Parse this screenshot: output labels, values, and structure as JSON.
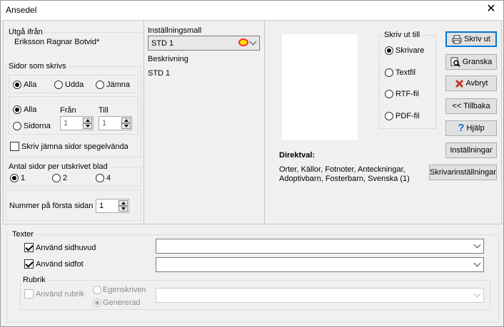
{
  "window": {
    "title": "Ansedel",
    "close_glyph": "✕"
  },
  "left": {
    "utga_fran": {
      "label": "Utgå ifrån",
      "value": "Eriksson Ragnar Botvid*"
    },
    "sidor_som_skrivs": {
      "label": "Sidor som skrivs",
      "parity_options": [
        "Alla",
        "Udda",
        "Jämna"
      ],
      "parity_selected": 0,
      "range_options": [
        "Alla",
        "Sidorna"
      ],
      "range_selected": 0,
      "from_label": "Från",
      "to_label": "Till",
      "from_value": "1",
      "to_value": "1"
    },
    "mirror": {
      "label": "Skriv jämna sidor spegelvända",
      "checked": false
    },
    "pages_per_sheet": {
      "label": "Antal sidor per utskrivet blad",
      "options": [
        "1",
        "2",
        "4"
      ],
      "selected": 0
    },
    "first_page_number": {
      "label": "Nummer på första sidan",
      "value": "1"
    }
  },
  "middle": {
    "template_label": "Inställningsmall",
    "template_value": "STD 1",
    "description_label": "Beskrivning",
    "description_value": "STD 1"
  },
  "right": {
    "print_to": {
      "label": "Skriv ut till",
      "options": [
        "Skrivare",
        "Textfil",
        "RTF-fil",
        "PDF-fil"
      ],
      "selected": 0
    },
    "direktval": {
      "label": "Direktval:",
      "line1": "Orter, Källor, Fotnoter, Anteckningar,",
      "line2": "Adoptivbarn, Fosterbarn, Svenska (1)"
    },
    "buttons": {
      "print": "Skriv ut",
      "preview": "Granska",
      "cancel": "Avbryt",
      "back": "<< Tillbaka",
      "help": "Hjälp",
      "settings": "Inställningar",
      "printer_settings": "Skrivarinställningar"
    }
  },
  "texts": {
    "label": "Texter",
    "header": {
      "label": "Använd sidhuvud",
      "checked": true,
      "value": ""
    },
    "footer": {
      "label": "Använd sidfot",
      "checked": true,
      "value": ""
    },
    "rubrik": {
      "label": "Rubrik",
      "use_label": "Använd rubrik",
      "options": [
        "Egenskriven",
        "Genererad"
      ],
      "selected": 1,
      "value": ""
    }
  },
  "colors": {
    "accent": "#0078d7",
    "cancel_red": "#c0392b",
    "help_blue": "#1e6fd9"
  },
  "icons": {
    "print": "printer-icon",
    "preview": "magnifier-icon",
    "cancel": "red-x-icon",
    "help": "question-icon"
  }
}
